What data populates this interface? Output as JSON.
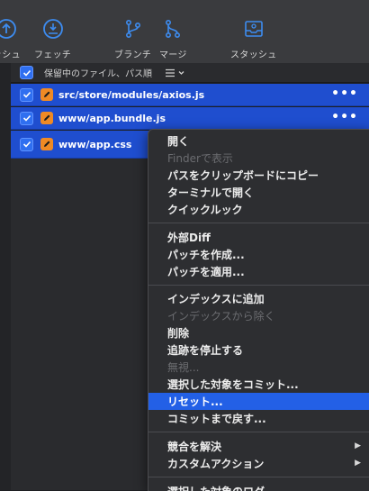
{
  "toolbar": {
    "items": [
      {
        "label": "ッシュ",
        "icon": "arrow-up-circle-icon"
      },
      {
        "label": "フェッチ",
        "icon": "fetch-icon"
      },
      {
        "label": "ブランチ",
        "icon": "branch-icon"
      },
      {
        "label": "マージ",
        "icon": "merge-icon"
      },
      {
        "label": "スタッシュ",
        "icon": "stash-icon"
      }
    ]
  },
  "filter": {
    "label": "保留中のファイル、パス順",
    "view_icon": "list-view-icon"
  },
  "files": [
    {
      "name": "src/store/modules/axios.js",
      "checked": true,
      "show_more": true
    },
    {
      "name": "www/app.bundle.js",
      "checked": true,
      "show_more": true
    },
    {
      "name": "www/app.css",
      "checked": true,
      "show_more": false
    }
  ],
  "more_glyph": "•••",
  "context_menu": {
    "groups": [
      [
        {
          "label": "開く",
          "enabled": true
        },
        {
          "label": "Finderで表示",
          "enabled": false
        },
        {
          "label": "パスをクリップボードにコピー",
          "enabled": true
        },
        {
          "label": "ターミナルで開く",
          "enabled": true
        },
        {
          "label": "クイックルック",
          "enabled": true
        }
      ],
      [
        {
          "label": "外部Diff",
          "enabled": true
        },
        {
          "label": "パッチを作成...",
          "enabled": true
        },
        {
          "label": "パッチを適用...",
          "enabled": true
        }
      ],
      [
        {
          "label": "インデックスに追加",
          "enabled": true
        },
        {
          "label": "インデックスから除く",
          "enabled": false
        },
        {
          "label": "削除",
          "enabled": true
        },
        {
          "label": "追跡を停止する",
          "enabled": true
        },
        {
          "label": "無視...",
          "enabled": false
        },
        {
          "label": "選択した対象をコミット...",
          "enabled": true
        },
        {
          "label": "リセット...",
          "enabled": true,
          "highlighted": true
        },
        {
          "label": "コミットまで戻す...",
          "enabled": true
        }
      ],
      [
        {
          "label": "競合を解決",
          "enabled": true,
          "submenu": true
        },
        {
          "label": "カスタムアクション",
          "enabled": true,
          "submenu": true
        }
      ],
      [
        {
          "label": "選択した対象のログ",
          "enabled": true
        }
      ]
    ]
  },
  "colors": {
    "selection": "#1f4ecf",
    "menu_highlight": "#2360e6",
    "checkbox": "#2f6ff0",
    "modified_badge": "#f08a24"
  }
}
